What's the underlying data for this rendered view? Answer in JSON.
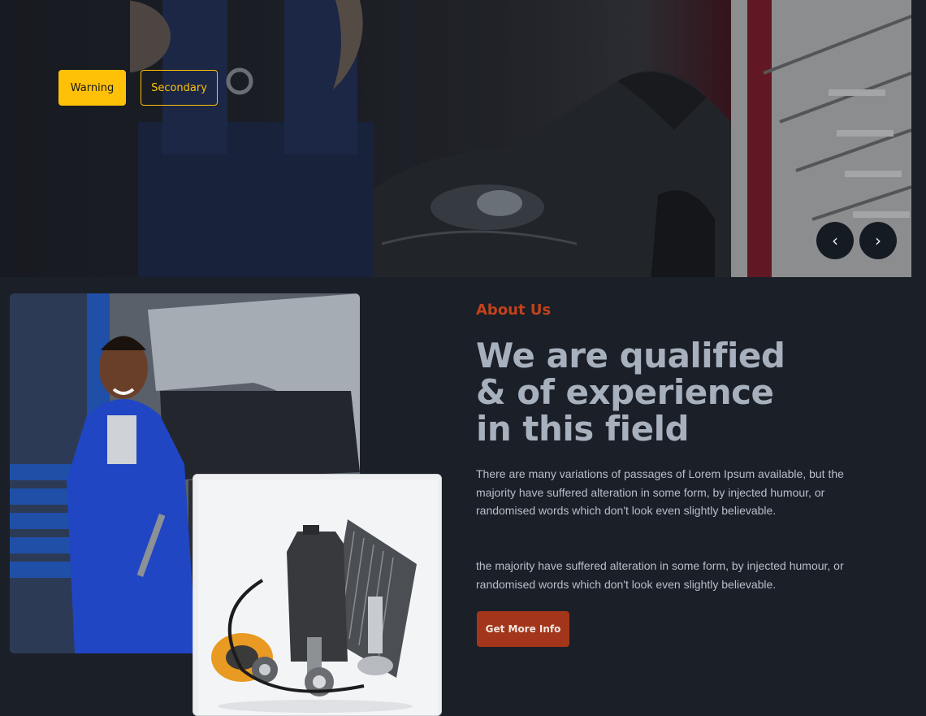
{
  "hero": {
    "buttons": {
      "warning_label": "Warning",
      "secondary_label": "Secondary"
    },
    "carousel": {
      "prev_icon": "‹",
      "next_icon": "›"
    }
  },
  "about": {
    "label": "About Us",
    "title_line1": "We are qualified",
    "title_line2": "& of experience",
    "title_line3": "in this field",
    "paragraph1": "There are many variations of passages of Lorem Ipsum available, but the majority have suffered alteration in some form, by injected humour, or randomised words which don't look even slightly believable.",
    "paragraph2": "the majority have suffered alteration in some form, by injected humour, or randomised words which don't look even slightly believable.",
    "cta_label": "Get More Info"
  },
  "colors": {
    "background": "#1b1f27",
    "warning": "#ffc107",
    "accent": "#c0431a",
    "cta": "#a3361a",
    "heading": "#a7b0bd"
  }
}
